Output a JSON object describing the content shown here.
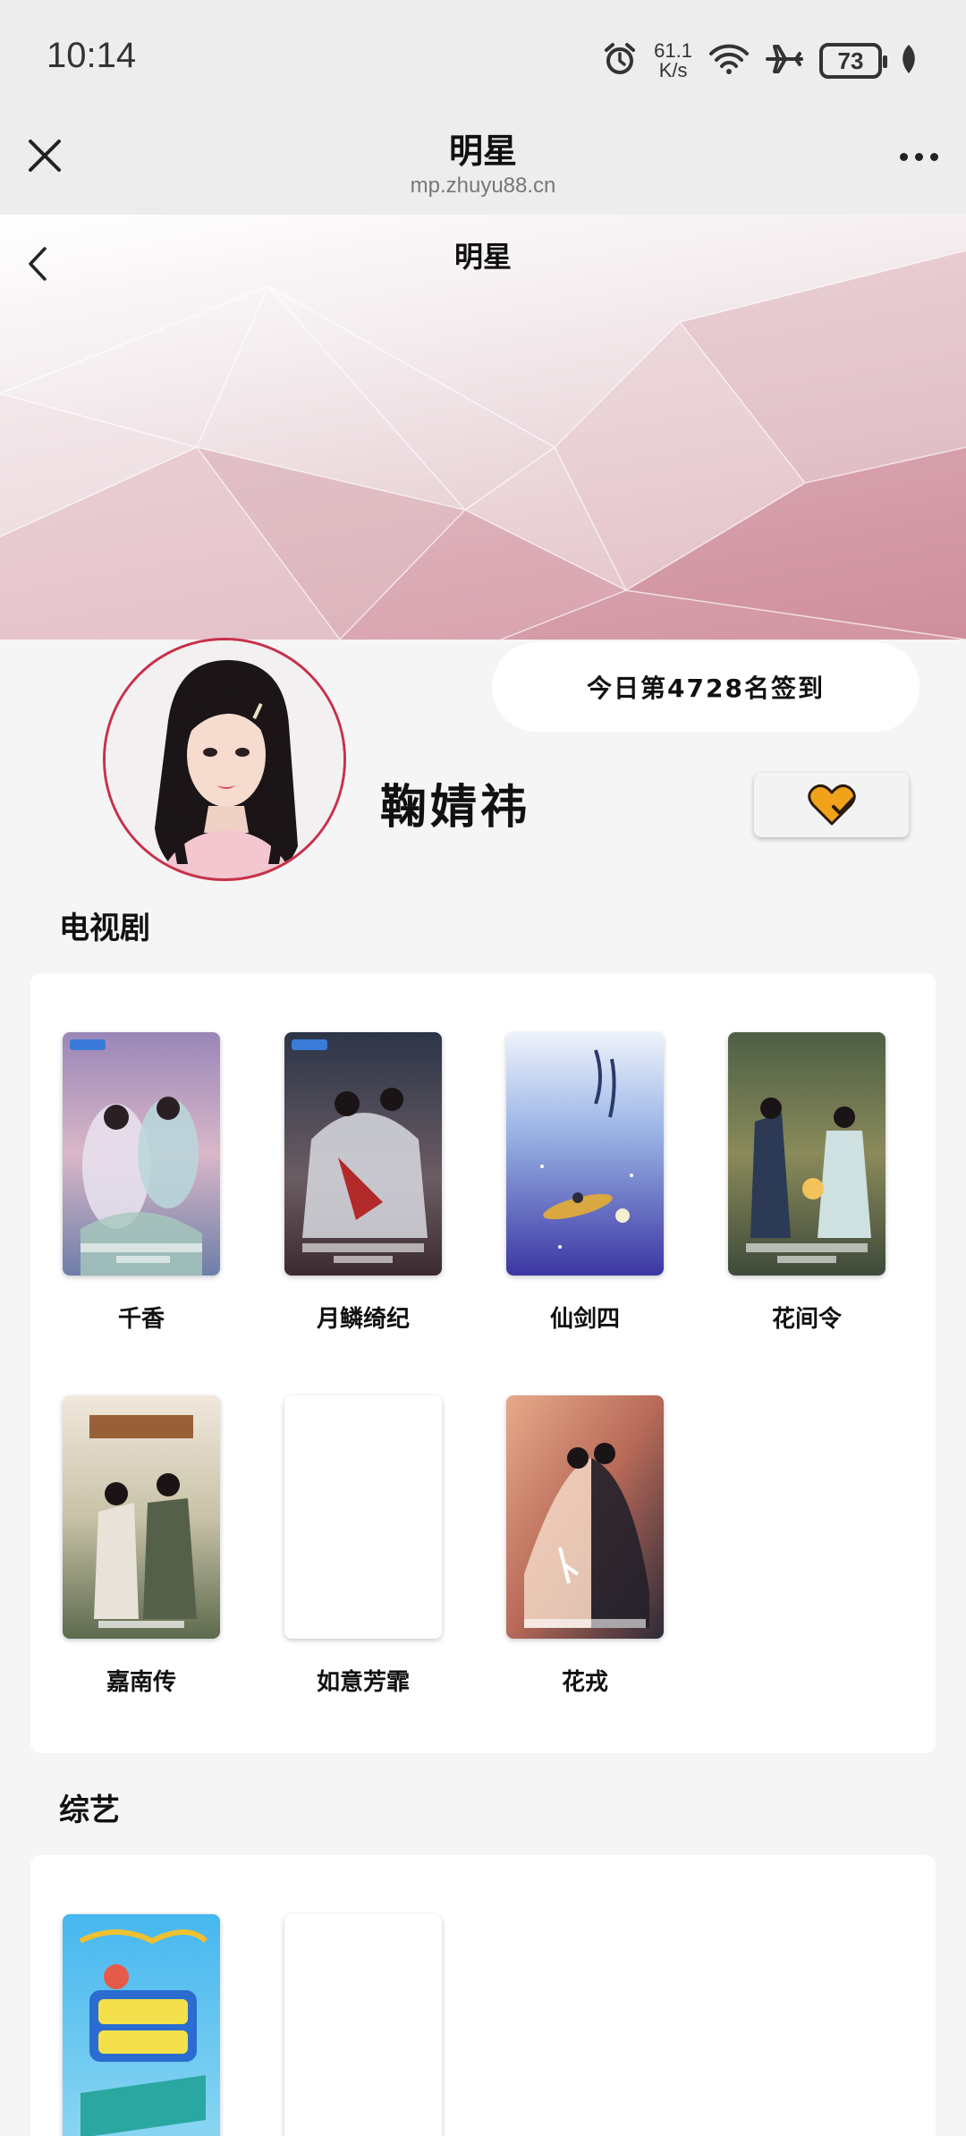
{
  "status_bar": {
    "time": "10:14",
    "net_speed_value": "61.1",
    "net_speed_unit": "K/s",
    "battery": "73"
  },
  "title_bar": {
    "title": "明星",
    "url": "mp.zhuyu88.cn"
  },
  "page": {
    "title": "明星"
  },
  "profile": {
    "name": "鞠婧祎",
    "signin_text": "今日第4728名签到"
  },
  "sections": {
    "tv": {
      "heading": "电视剧",
      "items": [
        {
          "title": "千香"
        },
        {
          "title": "月鳞绮纪"
        },
        {
          "title": "仙剑四"
        },
        {
          "title": "花间令"
        },
        {
          "title": "嘉南传"
        },
        {
          "title": "如意芳霏"
        },
        {
          "title": "花戎"
        }
      ]
    },
    "variety": {
      "heading": "综艺",
      "items": [
        {
          "title": ""
        },
        {
          "title": ""
        }
      ]
    }
  },
  "colors": {
    "accent_heart": "#f0a31a",
    "avatar_ring": "#c8304a",
    "banner_pink": "#d7a4ae"
  }
}
